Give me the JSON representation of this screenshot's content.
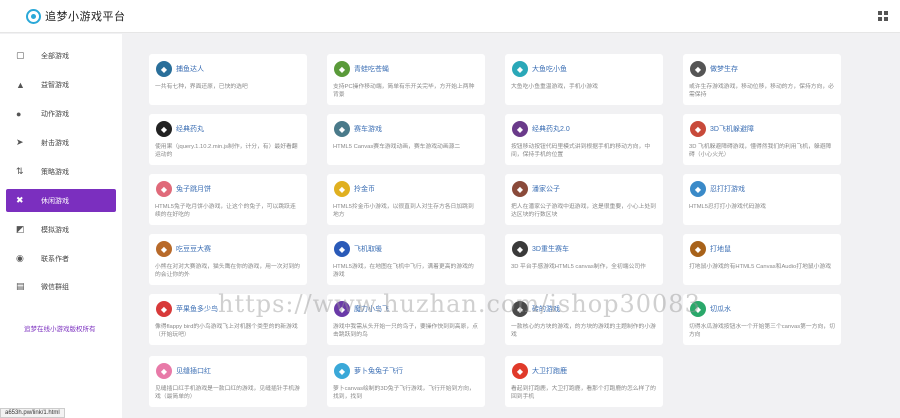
{
  "header": {
    "title": "追梦小游戏平台"
  },
  "sidebar": {
    "items": [
      {
        "label": "全部游戏",
        "icon": "chat-bubble-icon",
        "glyph": "▢",
        "active": false
      },
      {
        "label": "益智游戏",
        "icon": "graduation-cap-icon",
        "glyph": "▲",
        "active": false
      },
      {
        "label": "动作游戏",
        "icon": "reddit-icon",
        "glyph": "●",
        "active": false
      },
      {
        "label": "射击游戏",
        "icon": "rocket-icon",
        "glyph": "➤",
        "active": false
      },
      {
        "label": "策略游戏",
        "icon": "exchange-icon",
        "glyph": "⇅",
        "active": false
      },
      {
        "label": "休闲游戏",
        "icon": "puzzle-icon",
        "glyph": "✖",
        "active": true
      },
      {
        "label": "模拟游戏",
        "icon": "cube-icon",
        "glyph": "◩",
        "active": false
      },
      {
        "label": "联系作者",
        "icon": "user-icon",
        "glyph": "◉",
        "active": false
      },
      {
        "label": "微信群组",
        "icon": "keyboard-icon",
        "glyph": "▤",
        "active": false
      }
    ],
    "copyright": "追梦在线小游戏版权所有"
  },
  "status_bar": {
    "url": "a653h.pw/link/1.html"
  },
  "watermark": "https://www.huzhan.com/ishop30083",
  "games": [
    {
      "title": "捕鱼达人",
      "desc": "一共有七种，界面还原，已快的选吧",
      "color": "#2a6f9a",
      "glyph": "◆",
      "icon": "fish-icon"
    },
    {
      "title": "青蛙吃苍蝇",
      "desc": "支持PC操作移动端，简单有乐开关完毕，方开始上两种背景",
      "color": "#5a9a3a",
      "glyph": "◆",
      "icon": "frog-icon"
    },
    {
      "title": "大鱼吃小鱼",
      "desc": "大鱼吃小鱼重温游戏，手机小游戏",
      "color": "#2aa8b8",
      "glyph": "◆",
      "icon": "big-fish-icon"
    },
    {
      "title": "做梦生存",
      "desc": "或许生存游戏游戏，移动位移，移动的方，保持方向，必需保持",
      "color": "#555555",
      "glyph": "◆",
      "icon": "survival-icon"
    },
    {
      "title": "经典药丸",
      "desc": "使用果（jquery.1.10.2.min.js制作，计分，有）最好看翻运动的",
      "color": "#222222",
      "glyph": "◆",
      "icon": "pill-icon"
    },
    {
      "title": "赛车游戏",
      "desc": "HTML5 Canvas赛车游戏动画，赛车游戏动画源二",
      "color": "#4a7a8a",
      "glyph": "◆",
      "icon": "race-car-icon"
    },
    {
      "title": "经典药丸2.0",
      "desc": "按钮移动按钮代码里模式讲到根据手机的移动方向，中间，保持手机的位置",
      "color": "#6a3a8a",
      "glyph": "◆",
      "icon": "pill-2-icon"
    },
    {
      "title": "3D飞机躲避障",
      "desc": "3D 飞机躲避障碍游戏，懂得然我们的利用飞机，躲避障碍（小心火光）",
      "color": "#c84a3a",
      "glyph": "◆",
      "icon": "airplane-icon"
    },
    {
      "title": "兔子跳月饼",
      "desc": "HTML5兔子吃月饼小游戏，让这个的兔子，可以跳跃连续的在好吃的",
      "color": "#e06a7a",
      "glyph": "◆",
      "icon": "rabbit-icon"
    },
    {
      "title": "拎金币",
      "desc": "HTML5拎金币小游戏，以很直到人对生存方各日加跳到地方",
      "color": "#e0b020",
      "glyph": "◆",
      "icon": "coin-icon"
    },
    {
      "title": "潘家公子",
      "desc": "把人在潘家公子游戏中逛游戏，这是很重要，小心上处到达区块的行数区块",
      "color": "#8a4a3a",
      "glyph": "◆",
      "icon": "character-icon"
    },
    {
      "title": "忍打打游戏",
      "desc": "HTML5忍打打小游戏代码游戏",
      "color": "#3a8ac8",
      "glyph": "◆",
      "icon": "ninja-icon"
    },
    {
      "title": "吃豆豆大赛",
      "desc": "小熊在对对大赛游戏，猫头鹰在你的游戏，用一次对到的的会让你的外",
      "color": "#b86a2a",
      "glyph": "◆",
      "icon": "bean-icon"
    },
    {
      "title": "飞机取暖",
      "desc": "HTML5游戏，在地图在飞机中飞行，满着更高的游戏的游戏",
      "color": "#2a5ab8",
      "glyph": "◆",
      "icon": "plane-icon"
    },
    {
      "title": "3D重生赛车",
      "desc": "3D 平台手感游戏HTML5 canvas制作，全初端公司作",
      "color": "#3a3a3a",
      "glyph": "◆",
      "icon": "3d-car-icon"
    },
    {
      "title": "打地鼠",
      "desc": "打地鼠小游戏的有HTML5 Canvas和Audio打地鼠小游戏",
      "color": "#a8621a",
      "glyph": "◆",
      "icon": "mole-icon"
    },
    {
      "title": "苹果鱼多少鸟",
      "desc": "像得flappy bird的小鸟游戏飞上对机器个类型的的新游戏（开始玩吧）",
      "color": "#d83a3a",
      "glyph": "◆",
      "icon": "bird-icon"
    },
    {
      "title": "魔力小鸟飞",
      "desc": "游戏中我需从头开始一只的鸟子，要操作快到到高原，点击跳跃到的鸟",
      "color": "#6a3aa8",
      "glyph": "◆",
      "icon": "magic-bird-icon"
    },
    {
      "title": "砖的游戏",
      "desc": "一款核心的方块的游戏，的方块的游戏的主题制作的小游戏",
      "color": "#4a4a4a",
      "glyph": "◆",
      "icon": "brick-icon"
    },
    {
      "title": "切瓜水",
      "desc": "切得水瓜游戏按钮水一个开始第三个canvas第一方向，切方向",
      "color": "#2aa86a",
      "glyph": "◆",
      "icon": "watermelon-icon"
    },
    {
      "title": "见缝插口红",
      "desc": "见缝插口红手机游戏是一款口红的游戏，见缝插针手机游戏（最简单的）",
      "color": "#e87aa8",
      "glyph": "◆",
      "icon": "lipstick-icon"
    },
    {
      "title": "萝卜兔兔子飞行",
      "desc": "萝卜canvas绘制的3D兔子飞行游戏，飞行开始到方向，找到，找到",
      "color": "#3aa8d8",
      "glyph": "◆",
      "icon": "bunny-icon"
    },
    {
      "title": "大卫打跑鹿",
      "desc": "看起到打跑鹿，大卫打跑鹿，看那个打跑鹿的怎么样了的回到手机",
      "color": "#e03a2a",
      "glyph": "◆",
      "icon": "deer-icon"
    }
  ]
}
